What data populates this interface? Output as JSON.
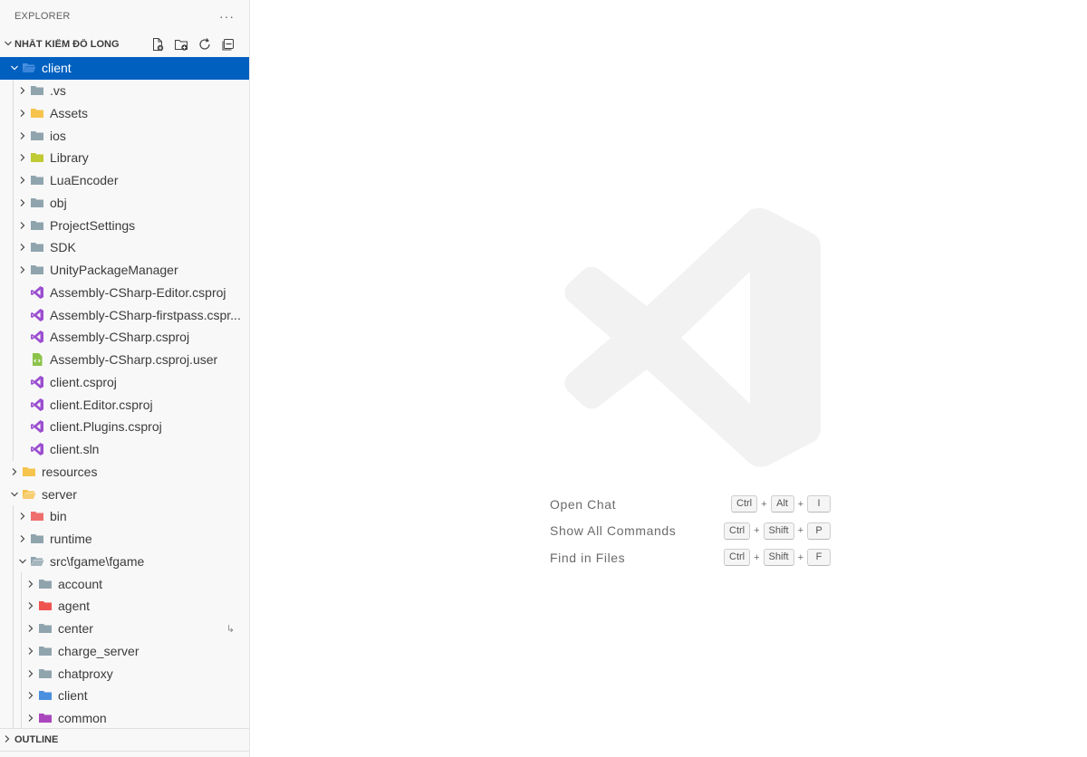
{
  "explorer": {
    "title": "EXPLORER",
    "more": "···"
  },
  "workspace": {
    "title": "NHẤT KIẾM ĐỒ LONG",
    "actions": [
      "new-file-icon",
      "new-folder-icon",
      "refresh-icon",
      "collapse-all-icon"
    ]
  },
  "tree": [
    {
      "label": "client",
      "depth": 0,
      "type": "folder",
      "expanded": true,
      "selected": true,
      "icon": "folder-client-icon",
      "color": "#4a8fe0"
    },
    {
      "label": ".vs",
      "depth": 1,
      "type": "folder",
      "expanded": false,
      "icon": "folder-icon",
      "color": "#90a4ae"
    },
    {
      "label": "Assets",
      "depth": 1,
      "type": "folder",
      "expanded": false,
      "icon": "folder-assets-icon",
      "color": "#f6c34d"
    },
    {
      "label": "ios",
      "depth": 1,
      "type": "folder",
      "expanded": false,
      "icon": "folder-ios-icon",
      "color": "#90a4ae"
    },
    {
      "label": "Library",
      "depth": 1,
      "type": "folder",
      "expanded": false,
      "icon": "folder-library-icon",
      "color": "#c0ca33"
    },
    {
      "label": "LuaEncoder",
      "depth": 1,
      "type": "folder",
      "expanded": false,
      "icon": "folder-icon",
      "color": "#90a4ae"
    },
    {
      "label": "obj",
      "depth": 1,
      "type": "folder",
      "expanded": false,
      "icon": "folder-icon",
      "color": "#90a4ae"
    },
    {
      "label": "ProjectSettings",
      "depth": 1,
      "type": "folder",
      "expanded": false,
      "icon": "folder-icon",
      "color": "#90a4ae"
    },
    {
      "label": "SDK",
      "depth": 1,
      "type": "folder",
      "expanded": false,
      "icon": "folder-icon",
      "color": "#90a4ae"
    },
    {
      "label": "UnityPackageManager",
      "depth": 1,
      "type": "folder",
      "expanded": false,
      "icon": "folder-icon",
      "color": "#90a4ae"
    },
    {
      "label": "Assembly-CSharp-Editor.csproj",
      "depth": 1,
      "type": "file",
      "icon": "visual-studio-icon",
      "color": "#9b4fd0"
    },
    {
      "label": "Assembly-CSharp-firstpass.cspr...",
      "depth": 1,
      "type": "file",
      "icon": "visual-studio-icon",
      "color": "#9b4fd0"
    },
    {
      "label": "Assembly-CSharp.csproj",
      "depth": 1,
      "type": "file",
      "icon": "visual-studio-icon",
      "color": "#9b4fd0"
    },
    {
      "label": "Assembly-CSharp.csproj.user",
      "depth": 1,
      "type": "file",
      "icon": "xml-file-icon",
      "color": "#8bc34a"
    },
    {
      "label": "client.csproj",
      "depth": 1,
      "type": "file",
      "icon": "visual-studio-icon",
      "color": "#9b4fd0"
    },
    {
      "label": "client.Editor.csproj",
      "depth": 1,
      "type": "file",
      "icon": "visual-studio-icon",
      "color": "#9b4fd0"
    },
    {
      "label": "client.Plugins.csproj",
      "depth": 1,
      "type": "file",
      "icon": "visual-studio-icon",
      "color": "#9b4fd0"
    },
    {
      "label": "client.sln",
      "depth": 1,
      "type": "file",
      "icon": "visual-studio-icon",
      "color": "#9b4fd0"
    },
    {
      "label": "resources",
      "depth": 0,
      "type": "folder",
      "expanded": false,
      "icon": "folder-resources-icon",
      "color": "#f6c34d"
    },
    {
      "label": "server",
      "depth": 0,
      "type": "folder",
      "expanded": true,
      "icon": "folder-server-open-icon",
      "color": "#f6c34d"
    },
    {
      "label": "bin",
      "depth": 1,
      "type": "folder",
      "expanded": false,
      "icon": "folder-bin-icon",
      "color": "#ef6f6f"
    },
    {
      "label": "runtime",
      "depth": 1,
      "type": "folder",
      "expanded": false,
      "icon": "folder-icon",
      "color": "#90a4ae"
    },
    {
      "label": "src\\fgame\\fgame",
      "depth": 1,
      "type": "folder",
      "expanded": true,
      "icon": "folder-open-icon",
      "color": "#90a4ae"
    },
    {
      "label": "account",
      "depth": 2,
      "type": "folder",
      "expanded": false,
      "icon": "folder-icon",
      "color": "#90a4ae"
    },
    {
      "label": "agent",
      "depth": 2,
      "type": "folder",
      "expanded": false,
      "icon": "folder-agent-icon",
      "color": "#ef5350"
    },
    {
      "label": "center",
      "depth": 2,
      "type": "folder",
      "expanded": false,
      "icon": "folder-icon",
      "color": "#90a4ae",
      "badge": "↳"
    },
    {
      "label": "charge_server",
      "depth": 2,
      "type": "folder",
      "expanded": false,
      "icon": "folder-icon",
      "color": "#90a4ae"
    },
    {
      "label": "chatproxy",
      "depth": 2,
      "type": "folder",
      "expanded": false,
      "icon": "folder-icon",
      "color": "#90a4ae"
    },
    {
      "label": "client",
      "depth": 2,
      "type": "folder",
      "expanded": false,
      "icon": "folder-client-icon",
      "color": "#4a8fe0"
    },
    {
      "label": "common",
      "depth": 2,
      "type": "folder",
      "expanded": false,
      "icon": "folder-common-icon",
      "color": "#ab47bc"
    }
  ],
  "outline": {
    "title": "OUTLINE"
  },
  "shortcuts": [
    {
      "label": "Open Chat",
      "keys": [
        "Ctrl",
        "Alt",
        "I"
      ]
    },
    {
      "label": "Show All Commands",
      "keys": [
        "Ctrl",
        "Shift",
        "P"
      ]
    },
    {
      "label": "Find in Files",
      "keys": [
        "Ctrl",
        "Shift",
        "F"
      ]
    }
  ],
  "shortcut_separator": "+",
  "colors": {
    "selection": "#0060c0",
    "sidebar_bg": "#f8f8f8",
    "watermark": "#f2f2f2"
  }
}
